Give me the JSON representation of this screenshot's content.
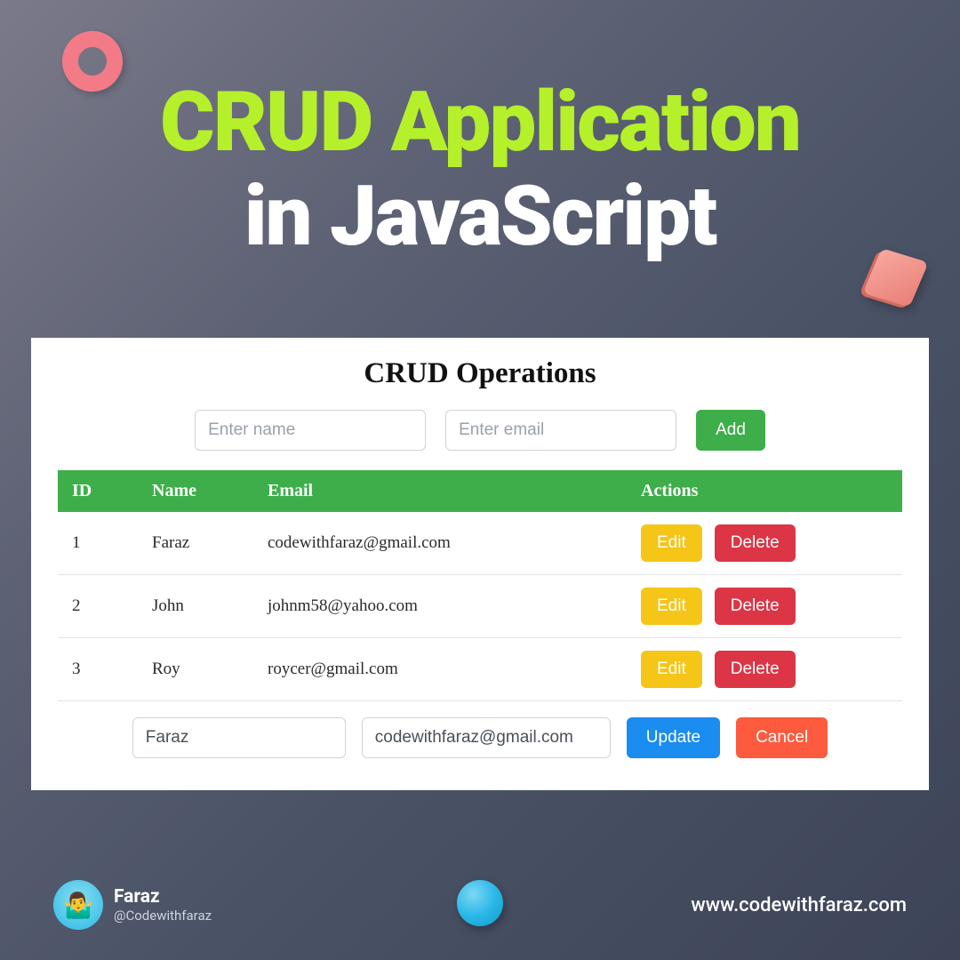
{
  "title": {
    "line1": "CRUD Application",
    "line2": "in JavaScript"
  },
  "card": {
    "heading": "CRUD Operations",
    "add_form": {
      "name_placeholder": "Enter name",
      "email_placeholder": "Enter email",
      "button_label": "Add"
    },
    "table": {
      "headers": {
        "id": "ID",
        "name": "Name",
        "email": "Email",
        "actions": "Actions"
      },
      "rows": [
        {
          "id": "1",
          "name": "Faraz",
          "email": "codewithfaraz@gmail.com"
        },
        {
          "id": "2",
          "name": "John",
          "email": "johnm58@yahoo.com"
        },
        {
          "id": "3",
          "name": "Roy",
          "email": "roycer@gmail.com"
        }
      ],
      "edit_label": "Edit",
      "delete_label": "Delete"
    },
    "edit_form": {
      "name_value": "Faraz",
      "email_value": "codewithfaraz@gmail.com",
      "update_label": "Update",
      "cancel_label": "Cancel"
    }
  },
  "footer": {
    "name": "Faraz",
    "handle": "@Codewithfaraz",
    "url": "www.codewithfaraz.com",
    "avatar_emoji": "🤷‍♂️"
  }
}
